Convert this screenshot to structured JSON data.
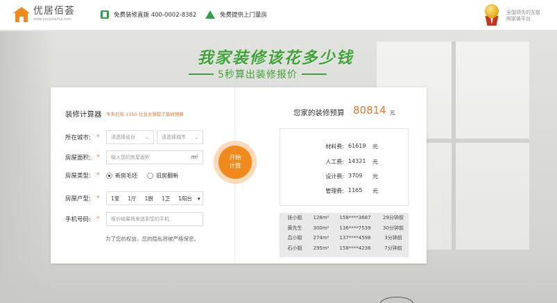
{
  "header": {
    "logo_name": "优居佰荟",
    "logo_url": "www.youjubaihui.com",
    "hotline_label": "免费装修直拨 400-0002-8382",
    "measure_label": "免费提供上门量房",
    "slogan": "全国领先的互联网家装平台"
  },
  "headline": {
    "title": "我家装修该花多少钱",
    "subtitle": "5秒算出装修报价"
  },
  "calculator": {
    "title": "装修计算器",
    "today_prefix": "今天已有",
    "today_count": "1350",
    "today_suffix": "位业主获取了装修预算",
    "city_label": "所在城市:",
    "province_placeholder": "请选择省份",
    "city_placeholder": "请选择城市",
    "area_label": "房屋面积:",
    "area_placeholder": "输入您的房屋面积",
    "area_unit": "m²",
    "type_label": "房屋类型:",
    "type_options": [
      "新房毛坯",
      "旧房翻新"
    ],
    "layout_label": "房屋户型:",
    "layout_values": [
      "1室",
      "1厅",
      "1厨",
      "1卫",
      "1阳台"
    ],
    "phone_label": "手机号码:",
    "phone_placeholder": "报价结果将发送到您的手机",
    "privacy": "为了您的权益，您的隐私将被严格保密。",
    "required_mark": "*",
    "start_line1": "开始",
    "start_line2": "计算"
  },
  "budget": {
    "label": "您家的装修预算",
    "value": "80814",
    "unit": "元",
    "items": [
      {
        "name": "材料费:",
        "value": "61619",
        "unit": "元"
      },
      {
        "name": "人工费:",
        "value": "14321",
        "unit": "元"
      },
      {
        "name": "设计费:",
        "value": "3709",
        "unit": "元"
      },
      {
        "name": "管理费:",
        "value": "1165",
        "unit": "元"
      }
    ]
  },
  "recent": [
    {
      "name": "张小姐",
      "area": "128m²",
      "phone": "158****3687",
      "time": "29分钟前"
    },
    {
      "name": "黄先生",
      "area": "300m²",
      "phone": "136****7539",
      "time": "30分钟前"
    },
    {
      "name": "吕小姐",
      "area": "274m²",
      "phone": "137****4598",
      "time": "3分钟前"
    },
    {
      "name": "石小姐",
      "area": "295m²",
      "phone": "158****4236",
      "time": "7分钟前"
    }
  ]
}
